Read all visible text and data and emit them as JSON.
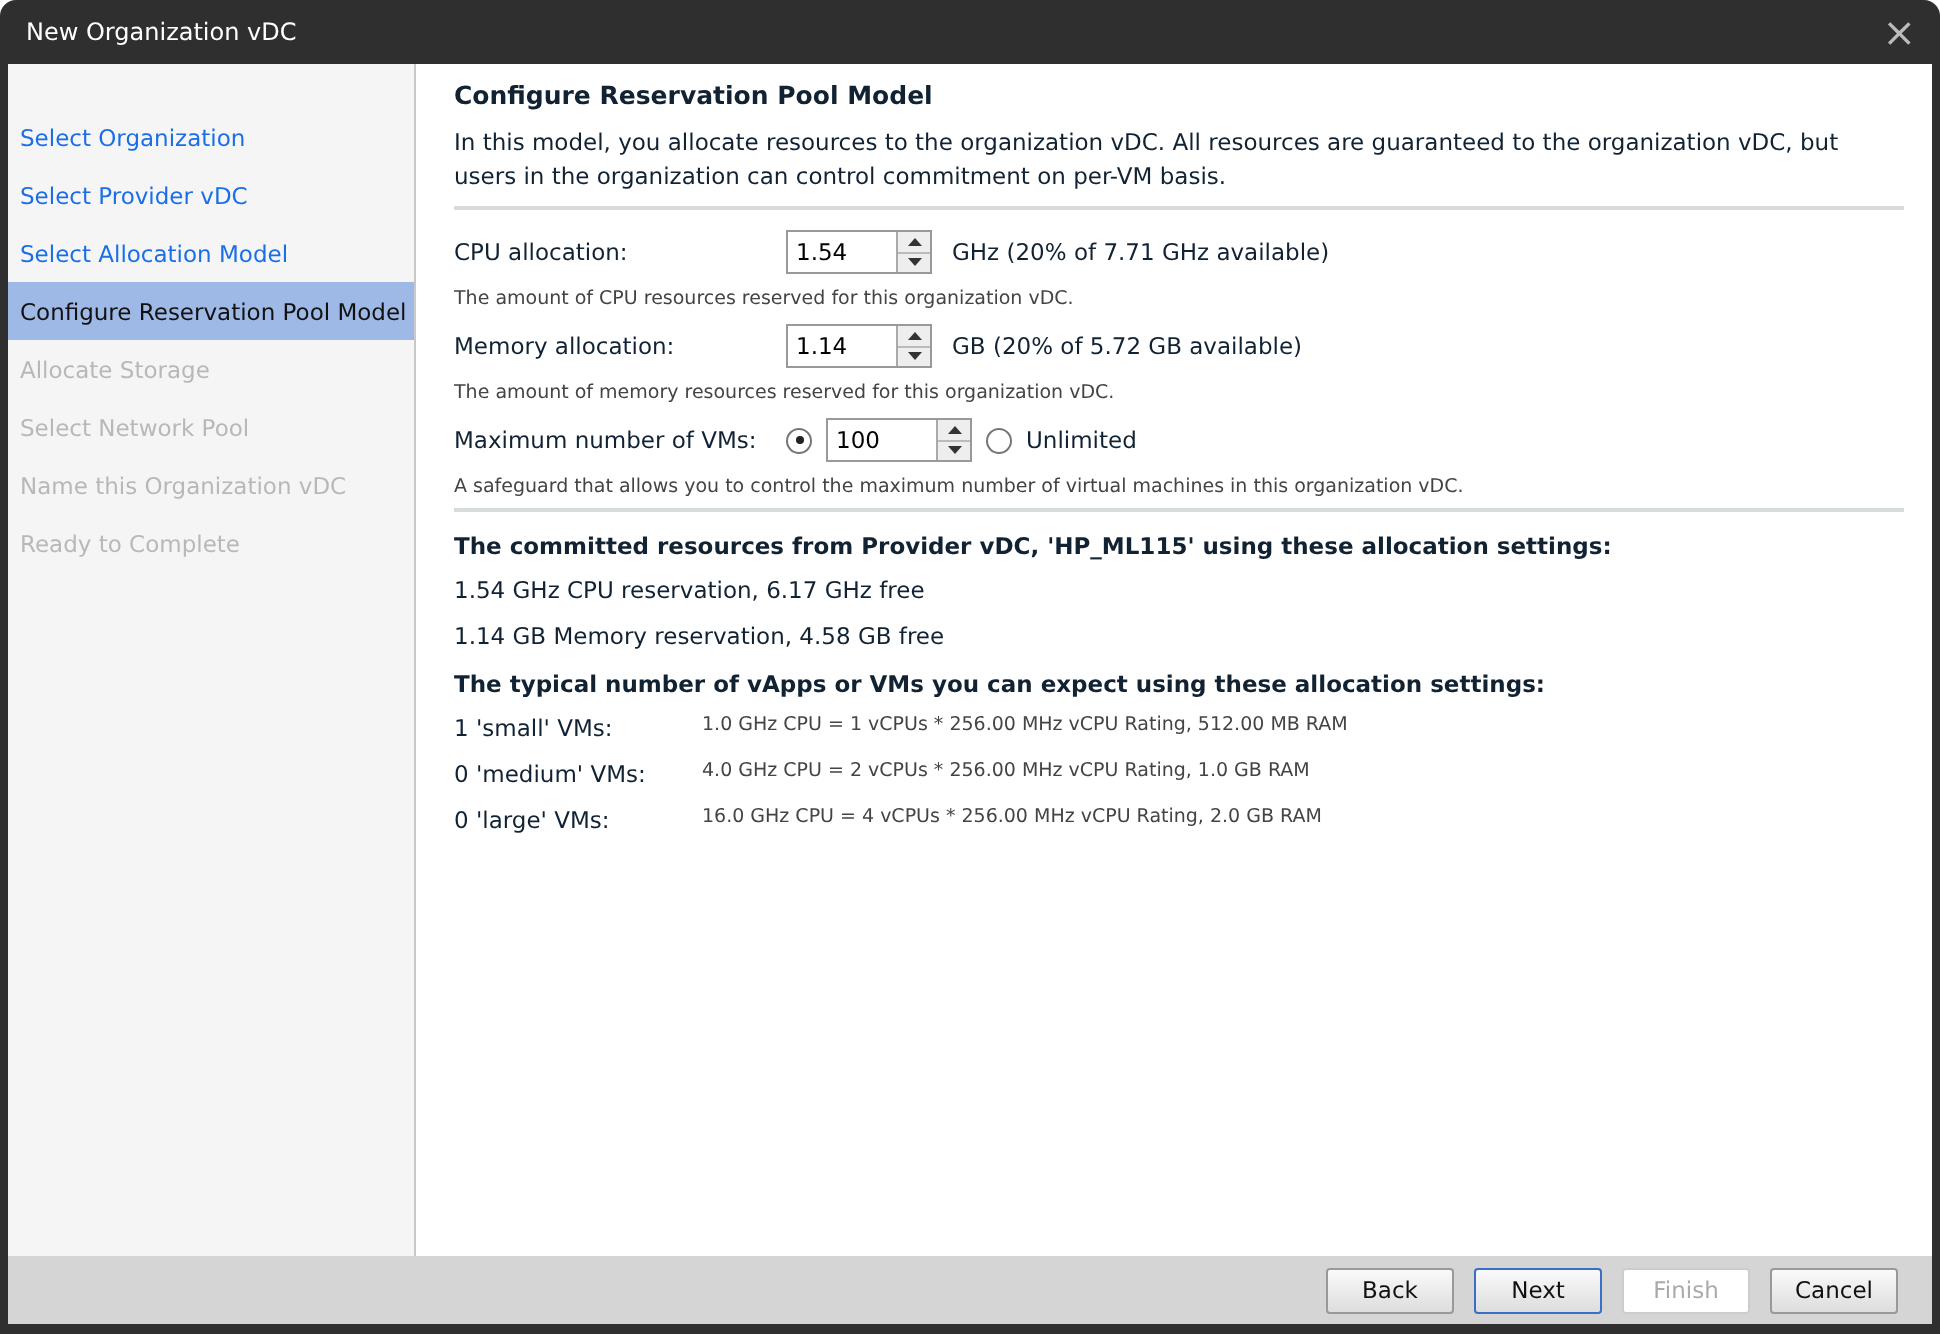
{
  "window": {
    "title": "New Organization vDC",
    "close": "×"
  },
  "sidebar": {
    "items": [
      {
        "label": "Select Organization",
        "selected": false,
        "disabled": false
      },
      {
        "label": "Select Provider vDC",
        "selected": false,
        "disabled": false
      },
      {
        "label": "Select Allocation Model",
        "selected": false,
        "disabled": false
      },
      {
        "label": "Configure Reservation Pool Model",
        "selected": true,
        "disabled": false
      },
      {
        "label": "Allocate Storage",
        "selected": false,
        "disabled": true
      },
      {
        "label": "Select Network Pool",
        "selected": false,
        "disabled": true
      },
      {
        "label": "Name this Organization vDC",
        "selected": false,
        "disabled": true
      },
      {
        "label": "Ready to Complete",
        "selected": false,
        "disabled": true
      }
    ]
  },
  "content": {
    "heading": "Configure Reservation Pool Model",
    "intro": "In this model, you allocate resources to the organization vDC. All resources are guaranteed to the organization vDC, but users in the organization can control commitment on per-VM basis.",
    "fields": [
      {
        "kind": "spinner",
        "label": "CPU allocation:",
        "value": "1.54",
        "unit": "GHz (20% of 7.71 GHz available)",
        "help": "The amount of CPU resources reserved for this organization vDC."
      },
      {
        "kind": "spinner",
        "label": "Memory allocation:",
        "value": "1.14",
        "unit": "GB (20% of 5.72 GB available)",
        "help": "The amount of memory resources reserved for this organization vDC."
      },
      {
        "kind": "radio_spinner",
        "label": "Maximum number of VMs:",
        "value": "100",
        "limited_selected": true,
        "unlimited_label": "Unlimited",
        "unlimited_selected": false,
        "help": "A safeguard that allows you to control the maximum number of virtual machines in this organization vDC."
      }
    ],
    "committed_heading": "The committed resources from Provider vDC, 'HP_ML115' using these allocation settings:",
    "committed": [
      "1.54 GHz CPU reservation, 6.17 GHz free",
      "1.14 GB Memory reservation, 4.58 GB free"
    ],
    "typical_heading": "The typical number of vApps or VMs you can expect using these allocation settings:",
    "typical": [
      {
        "label": "1 'small' VMs:",
        "detail": "1.0 GHz CPU = 1 vCPUs * 256.00 MHz vCPU Rating, 512.00 MB RAM"
      },
      {
        "label": "0 'medium' VMs:",
        "detail": "4.0 GHz CPU = 2 vCPUs * 256.00 MHz vCPU Rating, 1.0 GB RAM"
      },
      {
        "label": "0 'large' VMs:",
        "detail": "16.0 GHz CPU = 4 vCPUs * 256.00 MHz vCPU Rating, 2.0 GB RAM"
      }
    ]
  },
  "buttons": [
    {
      "label": "Back",
      "default": false,
      "disabled": false
    },
    {
      "label": "Next",
      "default": true,
      "disabled": false
    },
    {
      "label": "Finish",
      "default": false,
      "disabled": true
    },
    {
      "label": "Cancel",
      "default": false,
      "disabled": false
    }
  ]
}
